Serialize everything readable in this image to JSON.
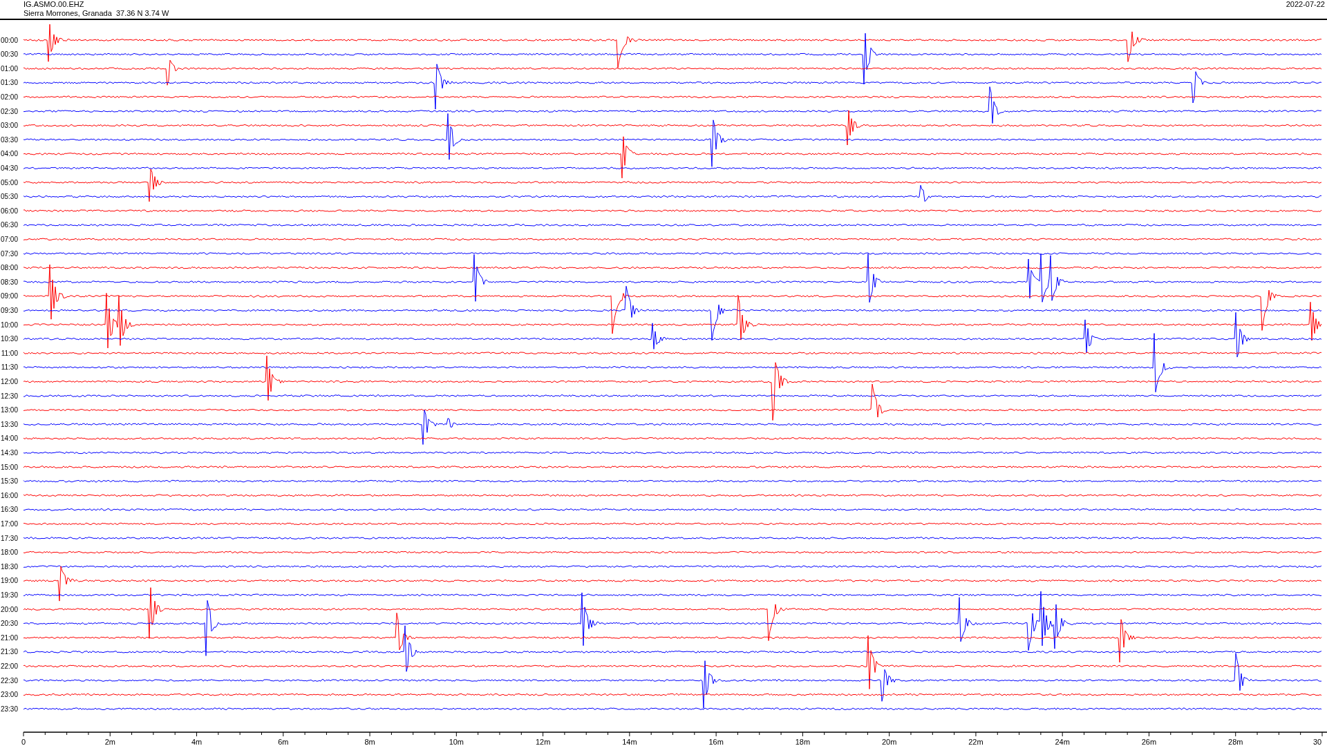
{
  "header": {
    "station": "IG.ASMO.00.EHZ",
    "location": "Sierra Morrones, Granada  37.36 N 3.74 W",
    "date": "2022-07-22"
  },
  "rows": [
    {
      "label": "00:00",
      "color": "#ff0000"
    },
    {
      "label": "00:30",
      "color": "#0000ff"
    },
    {
      "label": "01:00",
      "color": "#ff0000"
    },
    {
      "label": "01:30",
      "color": "#0000ff"
    },
    {
      "label": "02:00",
      "color": "#ff0000"
    },
    {
      "label": "02:30",
      "color": "#0000ff"
    },
    {
      "label": "03:00",
      "color": "#ff0000"
    },
    {
      "label": "03:30",
      "color": "#0000ff"
    },
    {
      "label": "04:00",
      "color": "#ff0000"
    },
    {
      "label": "04:30",
      "color": "#0000ff"
    },
    {
      "label": "05:00",
      "color": "#ff0000"
    },
    {
      "label": "05:30",
      "color": "#0000ff"
    },
    {
      "label": "06:00",
      "color": "#ff0000"
    },
    {
      "label": "06:30",
      "color": "#0000ff"
    },
    {
      "label": "07:00",
      "color": "#ff0000"
    },
    {
      "label": "07:30",
      "color": "#0000ff"
    },
    {
      "label": "08:00",
      "color": "#ff0000"
    },
    {
      "label": "08:30",
      "color": "#0000ff"
    },
    {
      "label": "09:00",
      "color": "#ff0000"
    },
    {
      "label": "09:30",
      "color": "#0000ff"
    },
    {
      "label": "10:00",
      "color": "#ff0000"
    },
    {
      "label": "10:30",
      "color": "#0000ff"
    },
    {
      "label": "11:00",
      "color": "#ff0000"
    },
    {
      "label": "11:30",
      "color": "#0000ff"
    },
    {
      "label": "12:00",
      "color": "#ff0000"
    },
    {
      "label": "12:30",
      "color": "#0000ff"
    },
    {
      "label": "13:00",
      "color": "#ff0000"
    },
    {
      "label": "13:30",
      "color": "#0000ff"
    },
    {
      "label": "14:00",
      "color": "#ff0000"
    },
    {
      "label": "14:30",
      "color": "#0000ff"
    },
    {
      "label": "15:00",
      "color": "#ff0000"
    },
    {
      "label": "15:30",
      "color": "#0000ff"
    },
    {
      "label": "16:00",
      "color": "#ff0000"
    },
    {
      "label": "16:30",
      "color": "#0000ff"
    },
    {
      "label": "17:00",
      "color": "#ff0000"
    },
    {
      "label": "17:30",
      "color": "#0000ff"
    },
    {
      "label": "18:00",
      "color": "#ff0000"
    },
    {
      "label": "18:30",
      "color": "#0000ff"
    },
    {
      "label": "19:00",
      "color": "#ff0000"
    },
    {
      "label": "19:30",
      "color": "#0000ff"
    },
    {
      "label": "20:00",
      "color": "#ff0000"
    },
    {
      "label": "20:30",
      "color": "#0000ff"
    },
    {
      "label": "21:00",
      "color": "#ff0000"
    },
    {
      "label": "21:30",
      "color": "#0000ff"
    },
    {
      "label": "22:00",
      "color": "#ff0000"
    },
    {
      "label": "22:30",
      "color": "#0000ff"
    },
    {
      "label": "23:00",
      "color": "#ff0000"
    },
    {
      "label": "23:30",
      "color": "#0000ff"
    }
  ],
  "x_axis": {
    "ticks": [
      "0",
      "2m",
      "4m",
      "6m",
      "8m",
      "10m",
      "12m",
      "14m",
      "16m",
      "18m",
      "20m",
      "22m",
      "24m",
      "26m",
      "28m",
      "30"
    ]
  }
}
